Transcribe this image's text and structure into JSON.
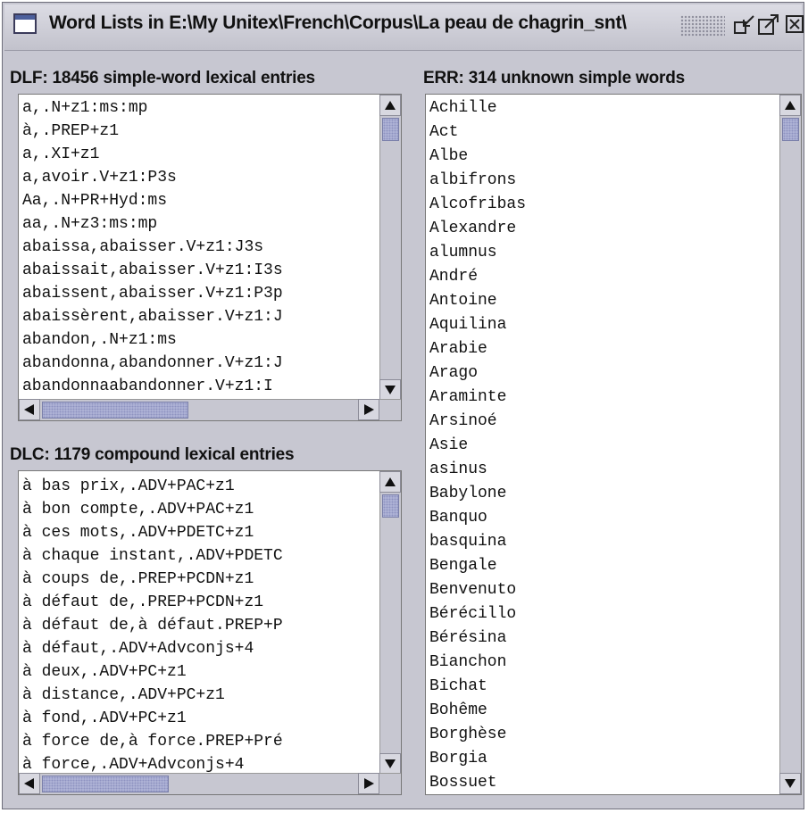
{
  "window": {
    "title": "Word Lists in E:\\My Unitex\\French\\Corpus\\La peau de chagrin_snt\\"
  },
  "dlf": {
    "label": "DLF: 18456 simple-word lexical entries",
    "items": [
      "a,.N+z1:ms:mp",
      "à,.PREP+z1",
      "a,.XI+z1",
      "a,avoir.V+z1:P3s",
      "Aa,.N+PR+Hyd:ms",
      "aa,.N+z3:ms:mp",
      "abaissa,abaisser.V+z1:J3s",
      "abaissait,abaisser.V+z1:I3s",
      "abaissent,abaisser.V+z1:P3p",
      "abaissèrent,abaisser.V+z1:J",
      "abandon,.N+z1:ms",
      "abandonna,abandonner.V+z1:J",
      "abandonnaabandonner.V+z1:I"
    ]
  },
  "dlc": {
    "label": "DLC: 1179 compound lexical entries",
    "items": [
      "à bas prix,.ADV+PAC+z1",
      "à bon compte,.ADV+PAC+z1",
      "à ces mots,.ADV+PDETC+z1",
      "à chaque instant,.ADV+PDETC",
      "à coups de,.PREP+PCDN+z1",
      "à défaut de,.PREP+PCDN+z1",
      "à défaut de,à défaut.PREP+P",
      "à défaut,.ADV+Advconjs+4",
      "à deux,.ADV+PC+z1",
      "à distance,.ADV+PC+z1",
      "à fond,.ADV+PC+z1",
      "à force de,à force.PREP+Pré",
      "à force,.ADV+Advconjs+4"
    ]
  },
  "err": {
    "label": "ERR: 314 unknown simple words",
    "items": [
      "Achille",
      "Act",
      "Albe",
      "albifrons",
      "Alcofribas",
      "Alexandre",
      "alumnus",
      "André",
      "Antoine",
      "Aquilina",
      "Arabie",
      "Arago",
      "Araminte",
      "Arsinoé",
      "Asie",
      "asinus",
      "Babylone",
      "Banquo",
      "basquina",
      "Bengale",
      "Benvenuto",
      "Bérécillo",
      "Bérésina",
      "Bianchon",
      "Bichat",
      "Bohême",
      "Borghèse",
      "Borgia",
      "Bossuet"
    ]
  },
  "icons": {
    "app": "window-icon",
    "minimize": "iconify-icon",
    "maximize": "maximize-icon",
    "close": "close-icon"
  },
  "scroll": {
    "dlf_vertical_fraction": 0.0,
    "dlf_horizontal_fraction": 0.0,
    "dlc_vertical_fraction": 0.0,
    "dlc_horizontal_fraction": 0.0,
    "err_vertical_fraction": 0.0
  }
}
